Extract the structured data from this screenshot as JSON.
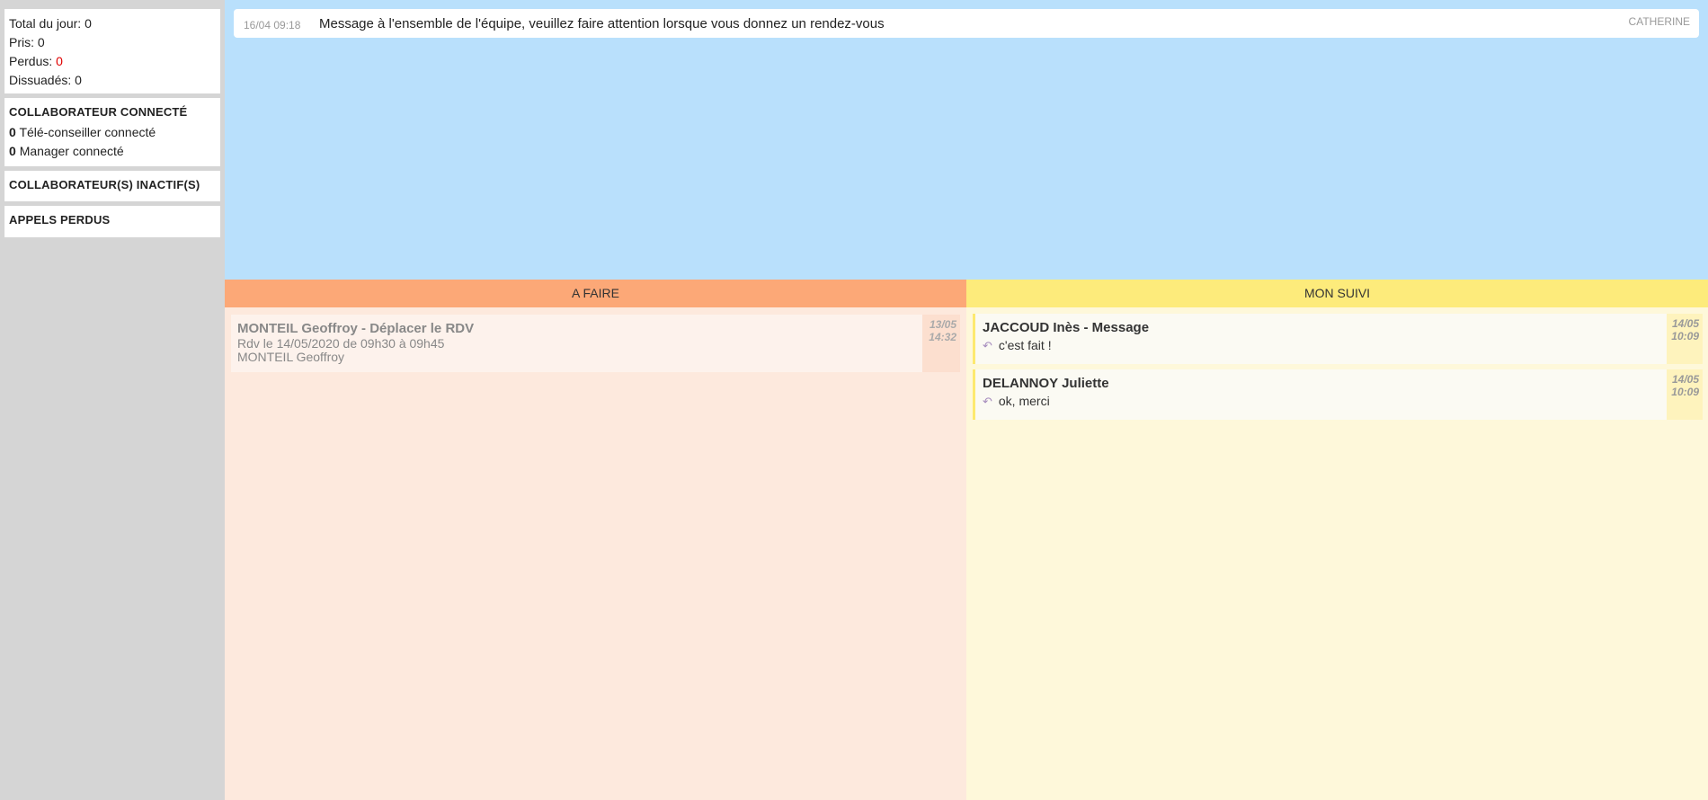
{
  "stats": {
    "total_label": "Total du jour:",
    "total_value": "0",
    "pris_label": "Pris:",
    "pris_value": "0",
    "perdus_label": "Perdus:",
    "perdus_value": "0",
    "dissuades_label": "Dissuadés:",
    "dissuades_value": "0"
  },
  "connected": {
    "heading": "COLLABORATEUR CONNECTÉ",
    "tele_count": "0",
    "tele_label": "Télé-conseiller connecté",
    "manager_count": "0",
    "manager_label": "Manager connecté"
  },
  "inactive": {
    "heading": "COLLABORATEUR(S) INACTIF(S)"
  },
  "missed": {
    "heading": "APPELS PERDUS"
  },
  "message": {
    "time": "16/04 09:18",
    "text": "Message à l'ensemble de l'équipe, veuillez faire attention lorsque vous donnez un rendez-vous",
    "author": "CATHERINE"
  },
  "todo": {
    "header": "A FAIRE",
    "items": [
      {
        "title": "MONTEIL Geoffroy -  Déplacer le RDV",
        "line1": "Rdv le 14/05/2020 de 09h30 à 09h45",
        "line2": "MONTEIL Geoffroy",
        "date": "13/05",
        "time": "14:32"
      }
    ]
  },
  "follow": {
    "header": "MON SUIVI",
    "items": [
      {
        "title": "JACCOUD Inès -  Message",
        "reply": "c'est fait !",
        "date": "14/05",
        "time": "10:09"
      },
      {
        "title": "DELANNOY Juliette",
        "reply": "ok, merci",
        "date": "14/05",
        "time": "10:09"
      }
    ]
  },
  "colors": {
    "perdus": "#e00000",
    "todo_header": "#fca877",
    "follow_header": "#fdeb7b",
    "messages_bg": "#b9e0fc"
  },
  "icons": {
    "reply": "reply-arrow-icon"
  }
}
